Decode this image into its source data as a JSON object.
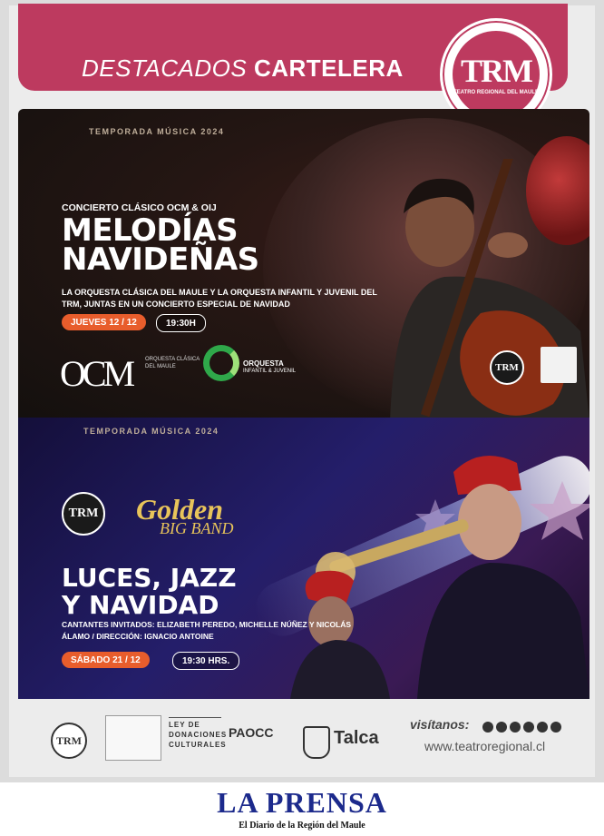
{
  "header": {
    "title_light": "DESTACADOS",
    "title_bold": "CARTELERA",
    "logo_mark": "TRM",
    "logo_sub": "TEATRO REGIONAL DEL MAULE"
  },
  "concert1": {
    "season": "TEMPORADA MÚSICA 2024",
    "kicker": "CONCIERTO CLÁSICO OCM & OIJ",
    "title_line1": "MELODÍAS",
    "title_line2": "NAVIDEÑAS",
    "description": "LA ORQUESTA CLÁSICA DEL MAULE Y LA ORQUESTA INFANTIL Y JUVENIL DEL TRM, JUNTAS EN UN CONCIERTO ESPECIAL DE NAVIDAD",
    "date": "JUEVES 12 / 12",
    "time": "19:30H",
    "ocm_logo": "OCM",
    "ocm_sub": "ORQUESTA CLÁSICA DEL MAULE",
    "oij_title": "ORQUESTA",
    "oij_sub": "INFANTIL & JUVENIL",
    "trm_small": "TRM"
  },
  "concert2": {
    "season": "TEMPORADA MÚSICA 2024",
    "trm_small": "TRM",
    "golden": "Golden",
    "bigband": "BIG BAND",
    "title_line1": "LUCES, JAZZ",
    "title_line2": "Y NAVIDAD",
    "guests": "CANTANTES INVITADOS: ELIZABETH PEREDO, MICHELLE NÚÑEZ Y NICOLÁS ÁLAMO / DIRECCIÓN: IGNACIO ANTOINE",
    "date": "SÁBADO 21 / 12",
    "time": "19:30 HRS."
  },
  "sponsors": {
    "trm": "TRM",
    "ley_line1": "LEY DE",
    "ley_line2": "DONACIONES",
    "ley_line3": "CULTURALES",
    "paocc": "PAOCC",
    "talca": "Talca"
  },
  "visit": {
    "label": "visítanos:",
    "url": "www.teatroregional.cl"
  },
  "newspaper": {
    "name": "LA PRENSA",
    "tagline": "El Diario de la Región del Maule"
  }
}
